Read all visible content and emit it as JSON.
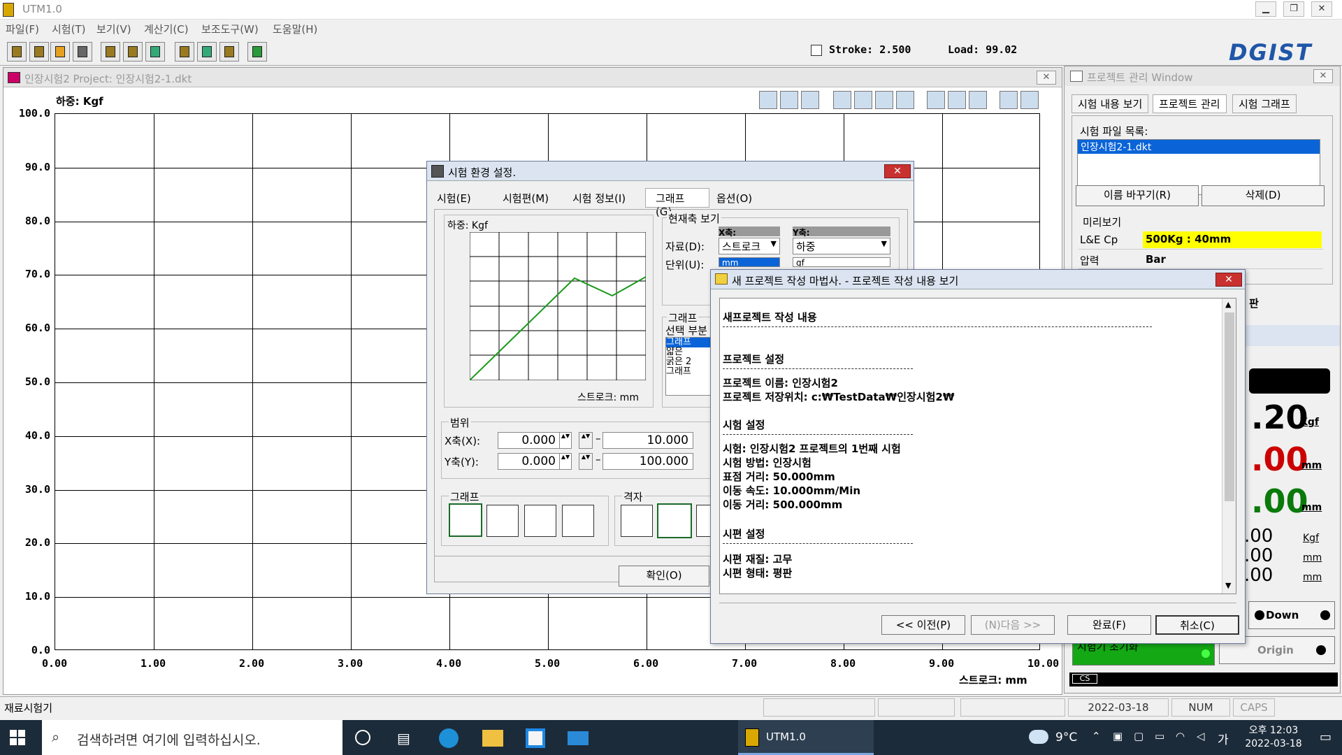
{
  "app": {
    "title": "UTM1.0"
  },
  "menu": [
    "파일(F)",
    "시험(T)",
    "보기(V)",
    "계산기(C)",
    "보조도구(W)",
    "도움말(H)"
  ],
  "status_strip": {
    "stroke": "Stroke: 2.500",
    "load": "Load: 99.02"
  },
  "logo": "DGIST",
  "graph_window": {
    "title": "인장시험2 Project: 인장시험2-1.dkt",
    "y_axis_label": "하중: Kgf",
    "x_axis_label": "스트로크: mm",
    "y_ticks": [
      "100.0",
      "90.0",
      "80.0",
      "70.0",
      "60.0",
      "50.0",
      "40.0",
      "30.0",
      "20.0",
      "10.0",
      "0.0"
    ],
    "x_ticks": [
      "0.00",
      "1.00",
      "2.00",
      "3.00",
      "4.00",
      "5.00",
      "6.00",
      "7.00",
      "8.00",
      "9.00",
      "10.00"
    ]
  },
  "project_window": {
    "title": "프로젝트 관리 Window",
    "tabs": [
      "시험 내용 보기",
      "프로젝트 관리",
      "시험 그래프"
    ],
    "file_list_label": "시험 파일 목록:",
    "file_selected": "인장시험2-1.dkt",
    "rename_button": "이름 바꾸기(R)",
    "delete_button": "삭제(D)",
    "preview_label": "미리보기",
    "preview_rows": [
      {
        "k": "L&E Cp",
        "v": "500Kg : 40mm"
      },
      {
        "k": "압력",
        "v": "Bar"
      }
    ],
    "partial_text": "판",
    "readings": {
      "load_big": ".20",
      "load_unit": "Kgf",
      "val2": ".00",
      "val2_unit": "mm",
      "val3": ".00",
      "val3_unit": "mm",
      "small1": ".00",
      "small1_unit": "Kgf",
      "small2": ".00",
      "small2_unit": "mm",
      "small3": ".00",
      "small3_unit": "mm"
    },
    "down_button": "Down",
    "origin_button": "Origin",
    "init_button": "시험기 초기화",
    "cs_label": "CS"
  },
  "env_dialog": {
    "title": "시험 환경 설정.",
    "tabs": [
      "시험(E)",
      "시험편(M)",
      "시험 정보(I)",
      "그래프(G)",
      "옵션(O)"
    ],
    "preview_y_label": "하중: Kgf",
    "preview_x_label": "스트로크: mm",
    "current_axis_label": "현재축 보기",
    "x_axis_head": "X축:",
    "y_axis_head": "Y축:",
    "data_label": "자료(D):",
    "unit_label": "단위(U):",
    "x_data": "스트로크",
    "y_data": "하중",
    "x_unit": "mm",
    "y_unit": "gf",
    "graph_group": "그래프",
    "select_part": "선택 부분",
    "graph_list": [
      "그래프",
      "얇은",
      "굵은 2",
      "그래프"
    ],
    "range_label": "범위",
    "x_range_label": "X축(X):",
    "y_range_label": "Y축(Y):",
    "x_min": "0.000",
    "x_max": "10.000",
    "y_min": "0.000",
    "y_max": "100.000",
    "graph_style_label": "그래프",
    "grid_label": "격자",
    "ok_button": "확인(O)"
  },
  "wizard_dialog": {
    "title": "새 프로젝트 작성 마법사.  - 프로젝트 작성 내용 보기",
    "lines": [
      "새프로젝트 작성 내용",
      "프로젝트 설정",
      "프로젝트 이름: 인장시험2",
      "프로젝트 저장위치: c:₩TestData₩인장시험2₩",
      "시험 설정",
      "시험: 인장시험2 프로젝트의  1번째 시험",
      "시험 방법: 인장시험",
      "표점 거리: 50.000mm",
      "이동 속도: 10.000mm/Min",
      "이동 거리: 500.000mm",
      "시편 설정",
      "시편 재질: 고무",
      "시편 형태: 평판"
    ],
    "prev_button": "<< 이전(P)",
    "next_button": "(N)다음 >>",
    "finish_button": "완료(F)",
    "cancel_button": "취소(C)"
  },
  "statusbar": {
    "left": "재료시험기",
    "date": "2022-03-18",
    "num": "NUM",
    "caps": "CAPS"
  },
  "taskbar": {
    "search_placeholder": "검색하려면 여기에 입력하십시오.",
    "active_app": "UTM1.0",
    "weather": "9°C",
    "ime": "가",
    "time": "오후 12:03",
    "date": "2022-03-18"
  },
  "colors": {
    "accent_select": "#0a64d8",
    "preview_yellow": "#ffff00",
    "green_button": "#14a814",
    "plot_line": "#1a9a1a"
  }
}
